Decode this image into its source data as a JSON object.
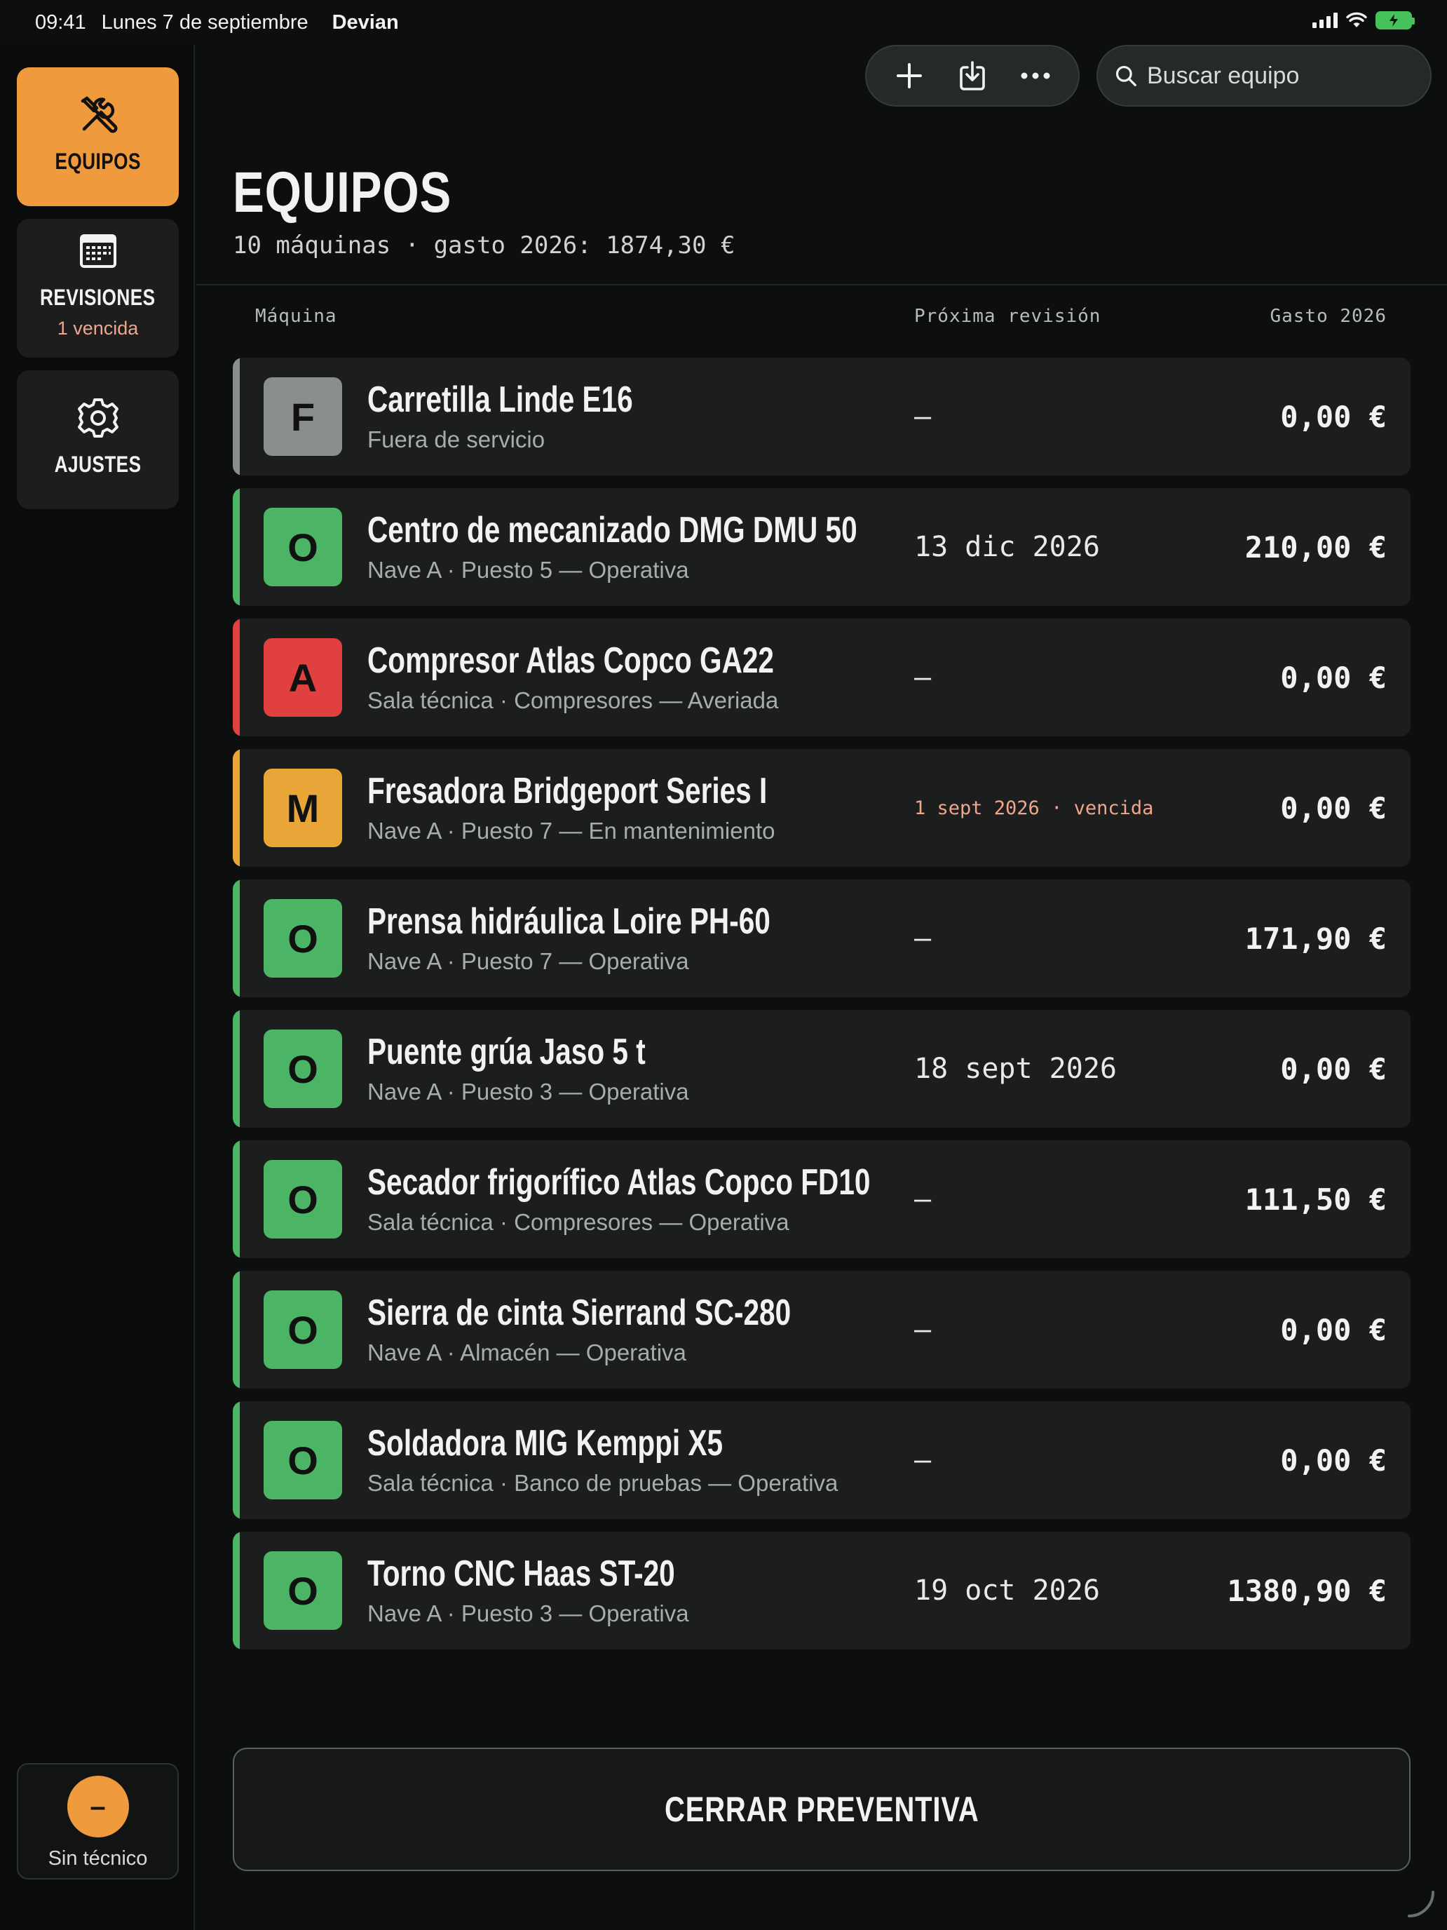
{
  "status_bar": {
    "time": "09:41",
    "date": "Lunes 7 de septiembre",
    "app_name": "Devian"
  },
  "sidebar": {
    "items": [
      {
        "label": "EQUIPOS",
        "icon": "tools-icon",
        "active": true
      },
      {
        "label": "REVISIONES",
        "icon": "calendar-icon",
        "sub": "1 vencida"
      },
      {
        "label": "AJUSTES",
        "icon": "gear-icon"
      }
    ],
    "technician": {
      "avatar": "–",
      "label": "Sin técnico"
    }
  },
  "toolbar": {
    "add_icon": "plus-icon",
    "import_icon": "download-tray-icon",
    "more_icon": "more-dots-icon"
  },
  "search": {
    "placeholder": "Buscar equipo"
  },
  "header": {
    "title": "EQUIPOS",
    "subtitle": "10 máquinas · gasto 2026: 1874,30 €"
  },
  "columns": {
    "machine": "Máquina",
    "next_review": "Próxima revisión",
    "cost": "Gasto 2026"
  },
  "colors": {
    "accent": "#ef9a3c",
    "operativa": "#4cb565",
    "averiada": "#e04040",
    "mantenimiento": "#e9a638",
    "fuera_servicio": "#8a8e8c"
  },
  "machines": [
    {
      "badge": "F",
      "status": "fuera",
      "name": "Carretilla Linde E16",
      "location": "Fuera de servicio",
      "next_review": "–",
      "overdue": false,
      "cost": "0,00 €"
    },
    {
      "badge": "O",
      "status": "operativa",
      "name": "Centro de mecanizado DMG DMU 50",
      "location": "Nave A · Puesto 5 — Operativa",
      "next_review": "13 dic 2026",
      "overdue": false,
      "cost": "210,00 €"
    },
    {
      "badge": "A",
      "status": "averiada",
      "name": "Compresor Atlas Copco GA22",
      "location": "Sala técnica · Compresores — Averiada",
      "next_review": "–",
      "overdue": false,
      "cost": "0,00 €"
    },
    {
      "badge": "M",
      "status": "mantenimiento",
      "name": "Fresadora Bridgeport Series I",
      "location": "Nave A · Puesto 7 — En mantenimiento",
      "next_review": "1 sept 2026 · vencida",
      "overdue": true,
      "cost": "0,00 €"
    },
    {
      "badge": "O",
      "status": "operativa",
      "name": "Prensa hidráulica Loire PH-60",
      "location": "Nave A · Puesto 7 — Operativa",
      "next_review": "–",
      "overdue": false,
      "cost": "171,90 €"
    },
    {
      "badge": "O",
      "status": "operativa",
      "name": "Puente grúa Jaso 5 t",
      "location": "Nave A · Puesto 3 — Operativa",
      "next_review": "18 sept 2026",
      "overdue": false,
      "cost": "0,00 €"
    },
    {
      "badge": "O",
      "status": "operativa",
      "name": "Secador frigorífico Atlas Copco FD10",
      "location": "Sala técnica · Compresores — Operativa",
      "next_review": "–",
      "overdue": false,
      "cost": "111,50 €"
    },
    {
      "badge": "O",
      "status": "operativa",
      "name": "Sierra de cinta Sierrand SC-280",
      "location": "Nave A · Almacén — Operativa",
      "next_review": "–",
      "overdue": false,
      "cost": "0,00 €"
    },
    {
      "badge": "O",
      "status": "operativa",
      "name": "Soldadora MIG Kemppi X5",
      "location": "Sala técnica · Banco de pruebas — Operativa",
      "next_review": "–",
      "overdue": false,
      "cost": "0,00 €"
    },
    {
      "badge": "O",
      "status": "operativa",
      "name": "Torno CNC Haas ST-20",
      "location": "Nave A · Puesto 3 — Operativa",
      "next_review": "19 oct 2026",
      "overdue": false,
      "cost": "1380,90 €"
    }
  ],
  "footer": {
    "close_label": "CERRAR PREVENTIVA"
  }
}
